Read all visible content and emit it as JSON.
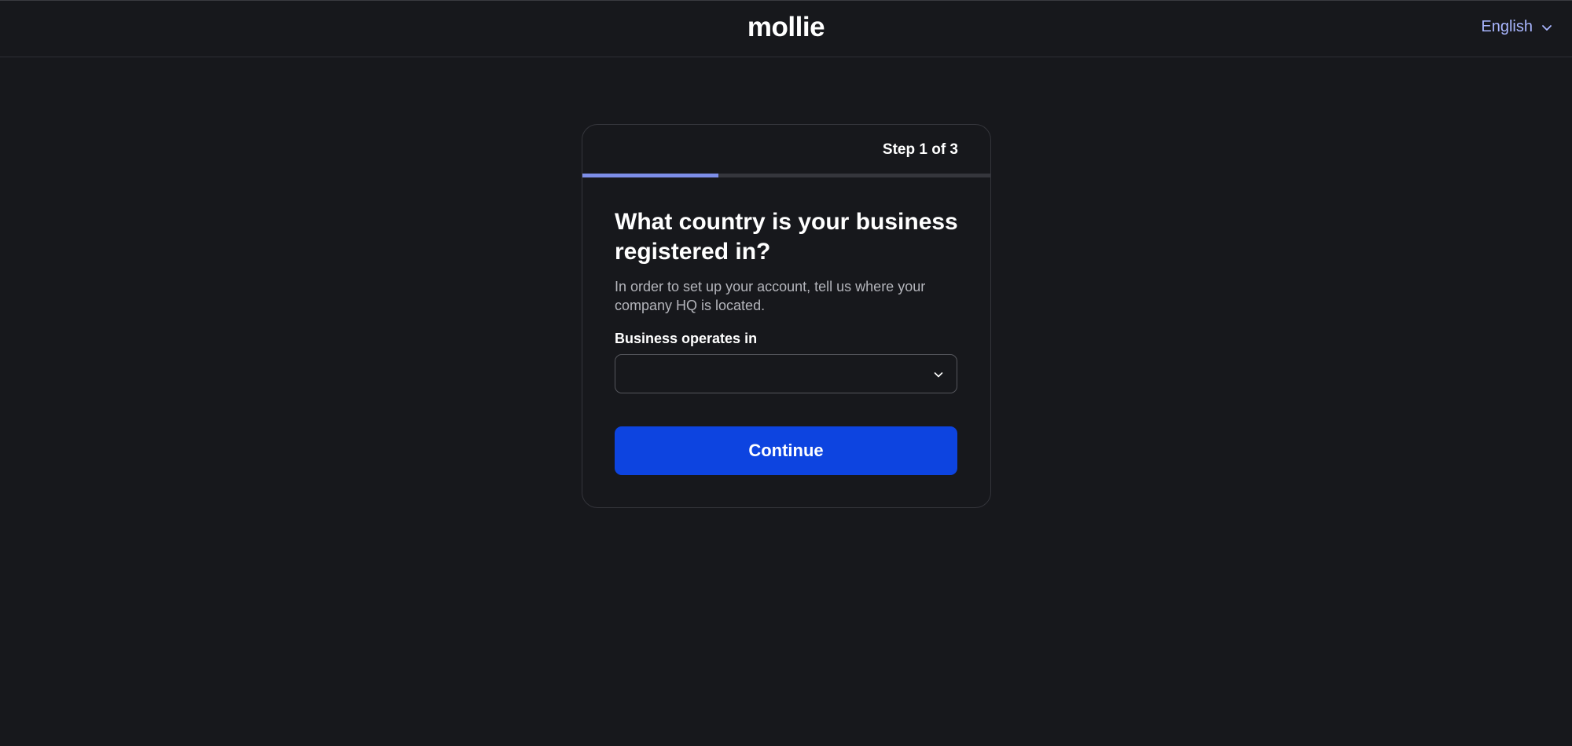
{
  "header": {
    "logo_text": "mollie",
    "language": "English",
    "language_icon": "chevron-down-icon"
  },
  "card": {
    "step_text": "Step 1 of 3",
    "progress_fraction": 0.333,
    "title": "What country is your business registered in?",
    "subtitle": "In order to set up your account, tell us where your company HQ is located.",
    "field_label": "Business operates in",
    "select_value": "",
    "select_icon": "chevron-down-icon",
    "continue_label": "Continue"
  },
  "colors": {
    "background": "#17181c",
    "accent_button": "#0d44e0",
    "progress_fill": "#7d8ee8",
    "language_link": "#a9b6ff"
  }
}
